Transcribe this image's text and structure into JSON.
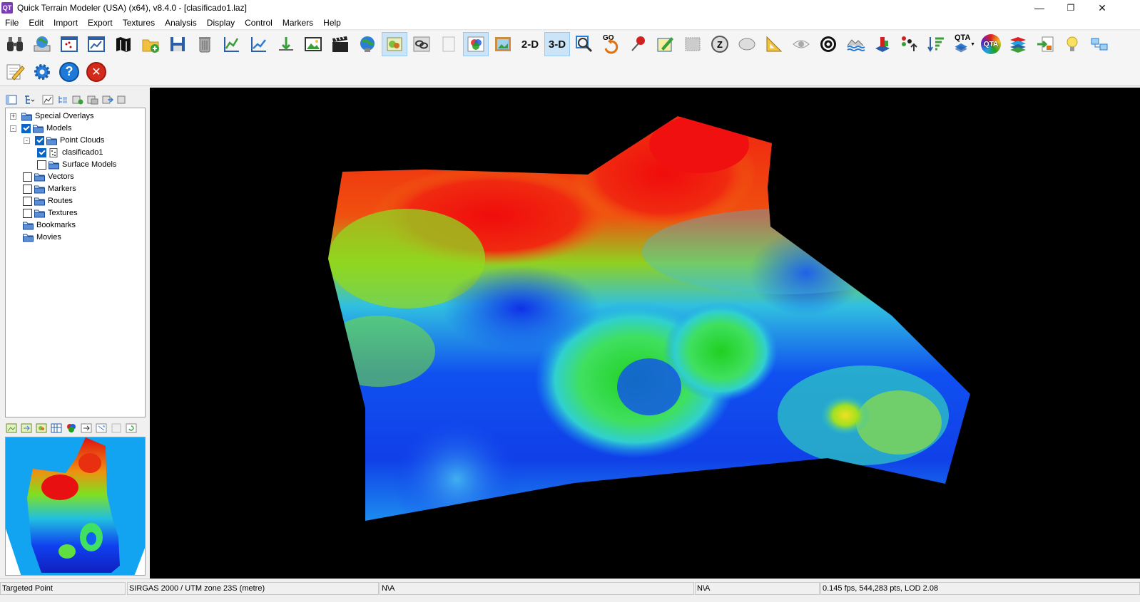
{
  "window": {
    "app_icon": "QT",
    "title": "Quick Terrain Modeler (USA) (x64), v8.4.0 - [clasificado1.laz]",
    "controls": [
      "minimize-icon",
      "restore-icon",
      "close-icon"
    ]
  },
  "menu": [
    "File",
    "Edit",
    "Import",
    "Export",
    "Textures",
    "Analysis",
    "Display",
    "Control",
    "Markers",
    "Help"
  ],
  "toolbar": {
    "two_d_label": "2-D",
    "three_d_label": "3-D",
    "go_label": "GO",
    "qta_label": "QTA",
    "qta_round_label": "QTA",
    "z_label": "Z"
  },
  "tree": {
    "items": [
      {
        "label": "Special Overlays"
      },
      {
        "label": "Models"
      },
      {
        "label": "Point Clouds"
      },
      {
        "label": "clasificado1"
      },
      {
        "label": "Surface Models"
      },
      {
        "label": "Vectors"
      },
      {
        "label": "Markers"
      },
      {
        "label": "Routes"
      },
      {
        "label": "Textures"
      },
      {
        "label": "Bookmarks"
      },
      {
        "label": "Movies"
      }
    ]
  },
  "status": {
    "mode": "Targeted Point",
    "crs": "SIRGAS 2000 / UTM zone 23S (metre)",
    "coord1": "N\\A",
    "coord2": "N\\A",
    "perf": "0.145 fps, 544,283 pts, LOD 2.08"
  },
  "colors": {
    "accent": "#0a64c8",
    "viewport_bg": "#000000",
    "overview_bg": "#12a4f0"
  }
}
